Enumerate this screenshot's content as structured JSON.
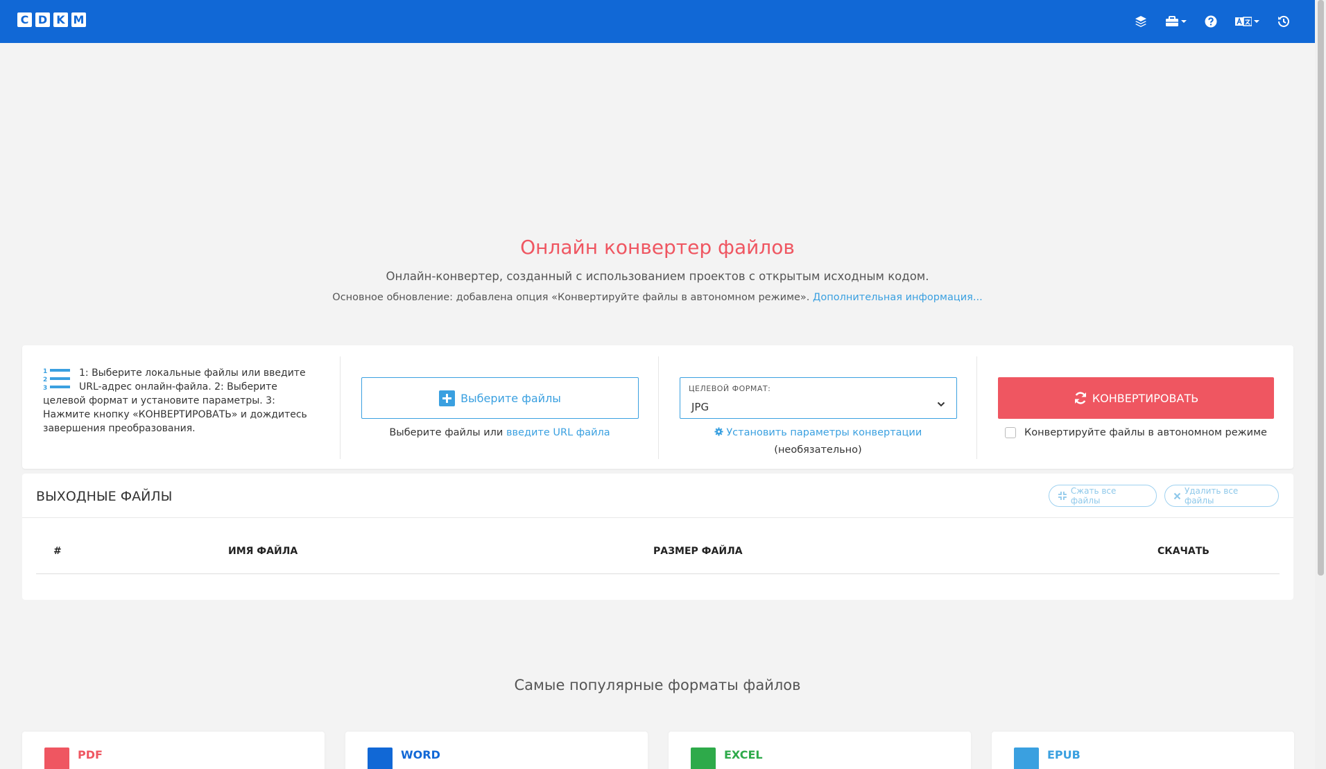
{
  "navbar": {
    "logo_letters": [
      "C",
      "D",
      "K",
      "M"
    ],
    "icons": [
      "layers-icon",
      "toolbox-icon",
      "help-icon",
      "language-icon",
      "history-icon"
    ]
  },
  "hero": {
    "title": "Онлайн конвертер файлов",
    "subtitle": "Онлайн-конвертер, созданный с использованием проектов с открытым исходным кодом.",
    "update_text": "Основное обновление: добавлена опция «Конвертируйте файлы в автономном режиме».",
    "update_link": "Дополнительная информация..."
  },
  "converter": {
    "steps": "1: Выберите локальные файлы или введите URL-адрес онлайн-файла. 2: Выберите целевой формат и установите параметры. 3: Нажмите кнопку «КОНВЕРТИРОВАТЬ» и дождитесь завершения преобразования.",
    "choose_button": "Выберите файлы",
    "choose_hint": "Выберите файлы или",
    "url_link": "введите URL файла",
    "format_label": "ЦЕЛЕВОЙ ФОРМАТ:",
    "format_value": "JPG",
    "params_link": "Установить параметры конвертации",
    "params_optional": "(необязательно)",
    "convert_button": "КОНВЕРТИРОВАТЬ",
    "offline_label": "Конвертируйте файлы в автономном режиме"
  },
  "output": {
    "title": "ВЫХОДНЫЕ ФАЙЛЫ",
    "compress_button": "Сжать все файлы",
    "delete_button": "Удалить все файлы",
    "columns": [
      "#",
      "ИМЯ ФАЙЛА",
      "РАЗМЕР ФАЙЛА",
      "СКАЧАТЬ"
    ]
  },
  "popular": {
    "title": "Самые популярные форматы файлов",
    "cards": [
      {
        "label": "PDF",
        "color": "#ef5661"
      },
      {
        "label": "WORD",
        "color": "#1168d6"
      },
      {
        "label": "EXCEL",
        "color": "#2eaa4a"
      },
      {
        "label": "EPUB",
        "color": "#3aa0e0"
      }
    ]
  },
  "colors": {
    "navbar": "#1168d6",
    "accent_red": "#ef5661",
    "link_blue": "#3aa0e0"
  }
}
